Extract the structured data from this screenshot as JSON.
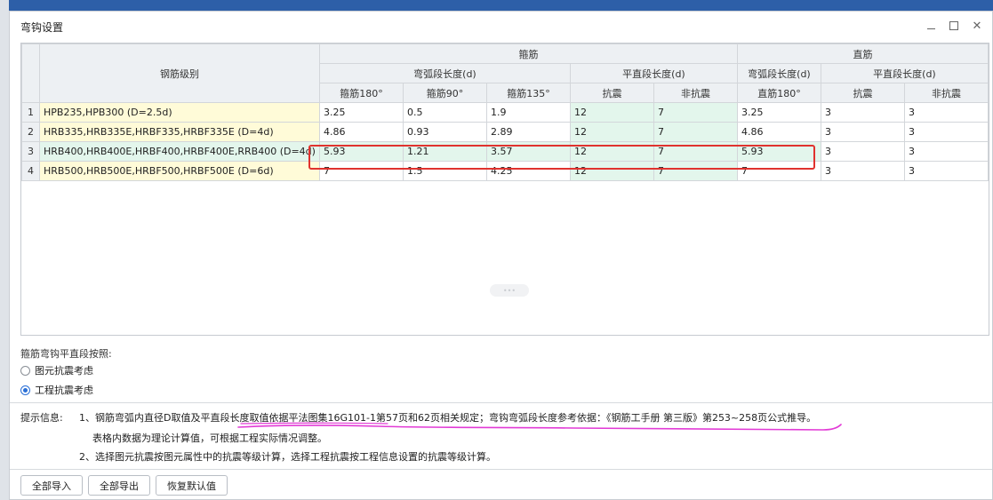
{
  "dialog": {
    "title": "弯钩设置"
  },
  "table": {
    "header": {
      "grade": "钢筋级别",
      "stirrup_group": "箍筋",
      "straight_group": "直筋",
      "stirrup_arc": "弯弧段长度(d)",
      "stirrup_flat": "平直段长度(d)",
      "straight_arc": "弯弧段长度(d)",
      "straight_flat": "平直段长度(d)",
      "cols": [
        "箍筋180°",
        "箍筋90°",
        "箍筋135°",
        "抗震",
        "非抗震",
        "直筋180°",
        "抗震",
        "非抗震"
      ]
    },
    "rows": [
      {
        "n": "1",
        "grade": "HPB235,HPB300 (D=2.5d)",
        "v": [
          "3.25",
          "0.5",
          "1.9",
          "12",
          "7",
          "3.25",
          "3",
          "3"
        ]
      },
      {
        "n": "2",
        "grade": "HRB335,HRB335E,HRBF335,HRBF335E (D=4d)",
        "v": [
          "4.86",
          "0.93",
          "2.89",
          "12",
          "7",
          "4.86",
          "3",
          "3"
        ]
      },
      {
        "n": "3",
        "grade": "HRB400,HRB400E,HRBF400,HRBF400E,RRB400 (D=4d)",
        "v": [
          "5.93",
          "1.21",
          "3.57",
          "12",
          "7",
          "5.93",
          "3",
          "3"
        ]
      },
      {
        "n": "4",
        "grade": "HRB500,HRB500E,HRBF500,HRBF500E (D=6d)",
        "v": [
          "7",
          "1.5",
          "4.25",
          "12",
          "7",
          "7",
          "3",
          "3"
        ]
      }
    ]
  },
  "options": {
    "label": "箍筋弯钩平直段按照:",
    "radio1": "图元抗震考虑",
    "radio2": "工程抗震考虑",
    "selected": "radio2"
  },
  "hints": {
    "label": "提示信息:",
    "line1": "1、钢筋弯弧内直径D取值及平直段长度取值依据平法图集16G101-1第57页和62页相关规定；弯钩弯弧段长度参考依据：《钢筋工手册 第三版》第253~258页公式推导。",
    "line2": "表格内数据为理论计算值，可根据工程实际情况调整。",
    "line3": "2、选择图元抗震按图元属性中的抗震等级计算，选择工程抗震按工程信息设置的抗震等级计算。"
  },
  "buttons": {
    "import_all": "全部导入",
    "export_all": "全部导出",
    "restore_default": "恢复默认值"
  },
  "colors": {
    "highlight_outline": "#e0322e",
    "annotation_underline": "#e23ad6",
    "green_cell": "#e3f6ec",
    "yellow_cell": "#fffbd8"
  }
}
